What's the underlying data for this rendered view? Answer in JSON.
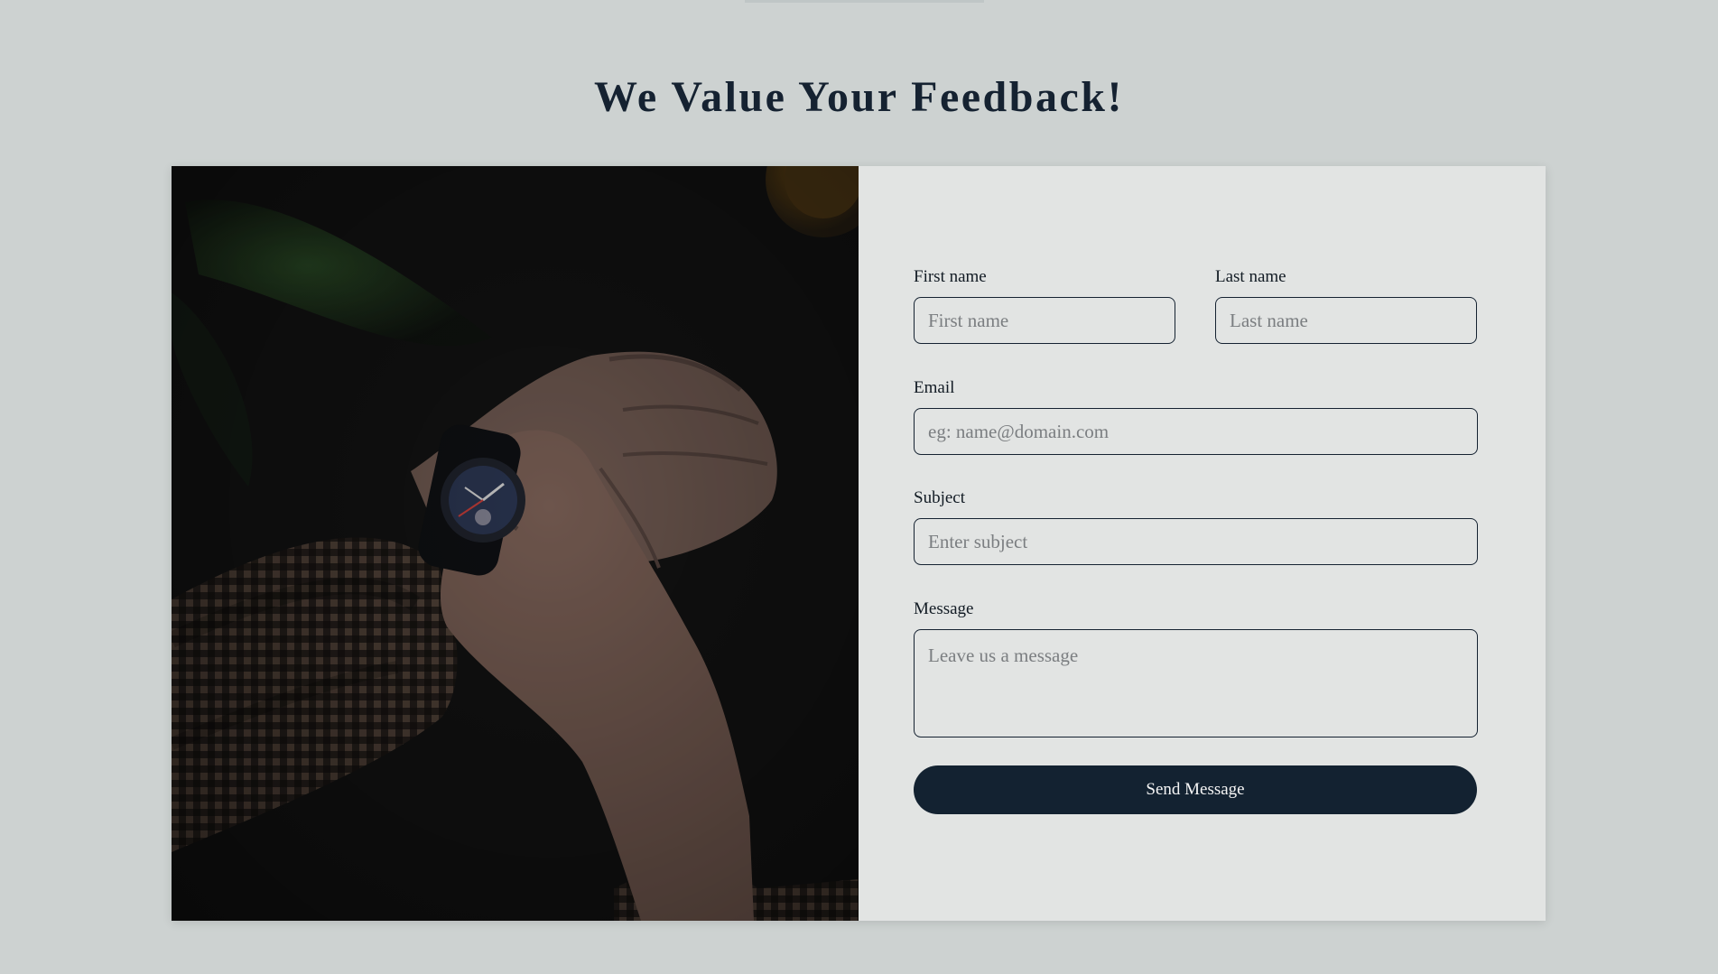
{
  "page": {
    "title": "We Value Your Feedback!"
  },
  "form": {
    "first_name": {
      "label": "First name",
      "placeholder": "First name",
      "value": ""
    },
    "last_name": {
      "label": "Last name",
      "placeholder": "Last name",
      "value": ""
    },
    "email": {
      "label": "Email",
      "placeholder": "eg: name@domain.com",
      "value": ""
    },
    "subject": {
      "label": "Subject",
      "placeholder": "Enter subject",
      "value": ""
    },
    "message": {
      "label": "Message",
      "placeholder": "Leave us a message",
      "value": ""
    },
    "submit_label": "Send Message"
  },
  "theme": {
    "background": "#cdd2d1",
    "panel": "#e2e4e3",
    "accent": "#132231"
  },
  "icons": {
    "photo": "wristwatch-photo"
  }
}
